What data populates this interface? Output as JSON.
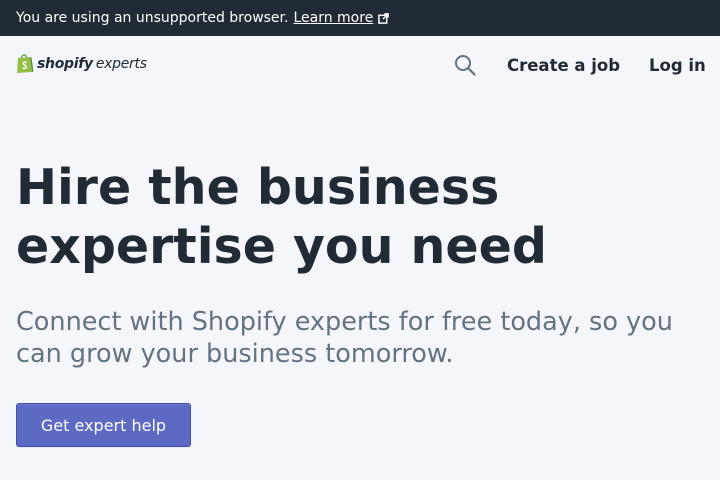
{
  "banner": {
    "message": "You are using an unsupported browser.",
    "link_label": "Learn more",
    "link_icon": "external-link-icon"
  },
  "header": {
    "logo": {
      "brand": "shopify",
      "sub": "experts",
      "icon": "shopify-bag-icon",
      "icon_color": "#95bf47"
    },
    "search_icon": "search-icon",
    "create_job_label": "Create a job",
    "login_label": "Log in"
  },
  "hero": {
    "title": "Hire the business expertise you need",
    "subtitle": "Connect with Shopify experts for free today, so you can grow your business tomorrow.",
    "cta_label": "Get expert help"
  },
  "colors": {
    "banner_bg": "#212b36",
    "page_bg": "#f4f6fb",
    "heading": "#212b36",
    "subtext": "#637381",
    "accent": "#5c6ac4"
  }
}
